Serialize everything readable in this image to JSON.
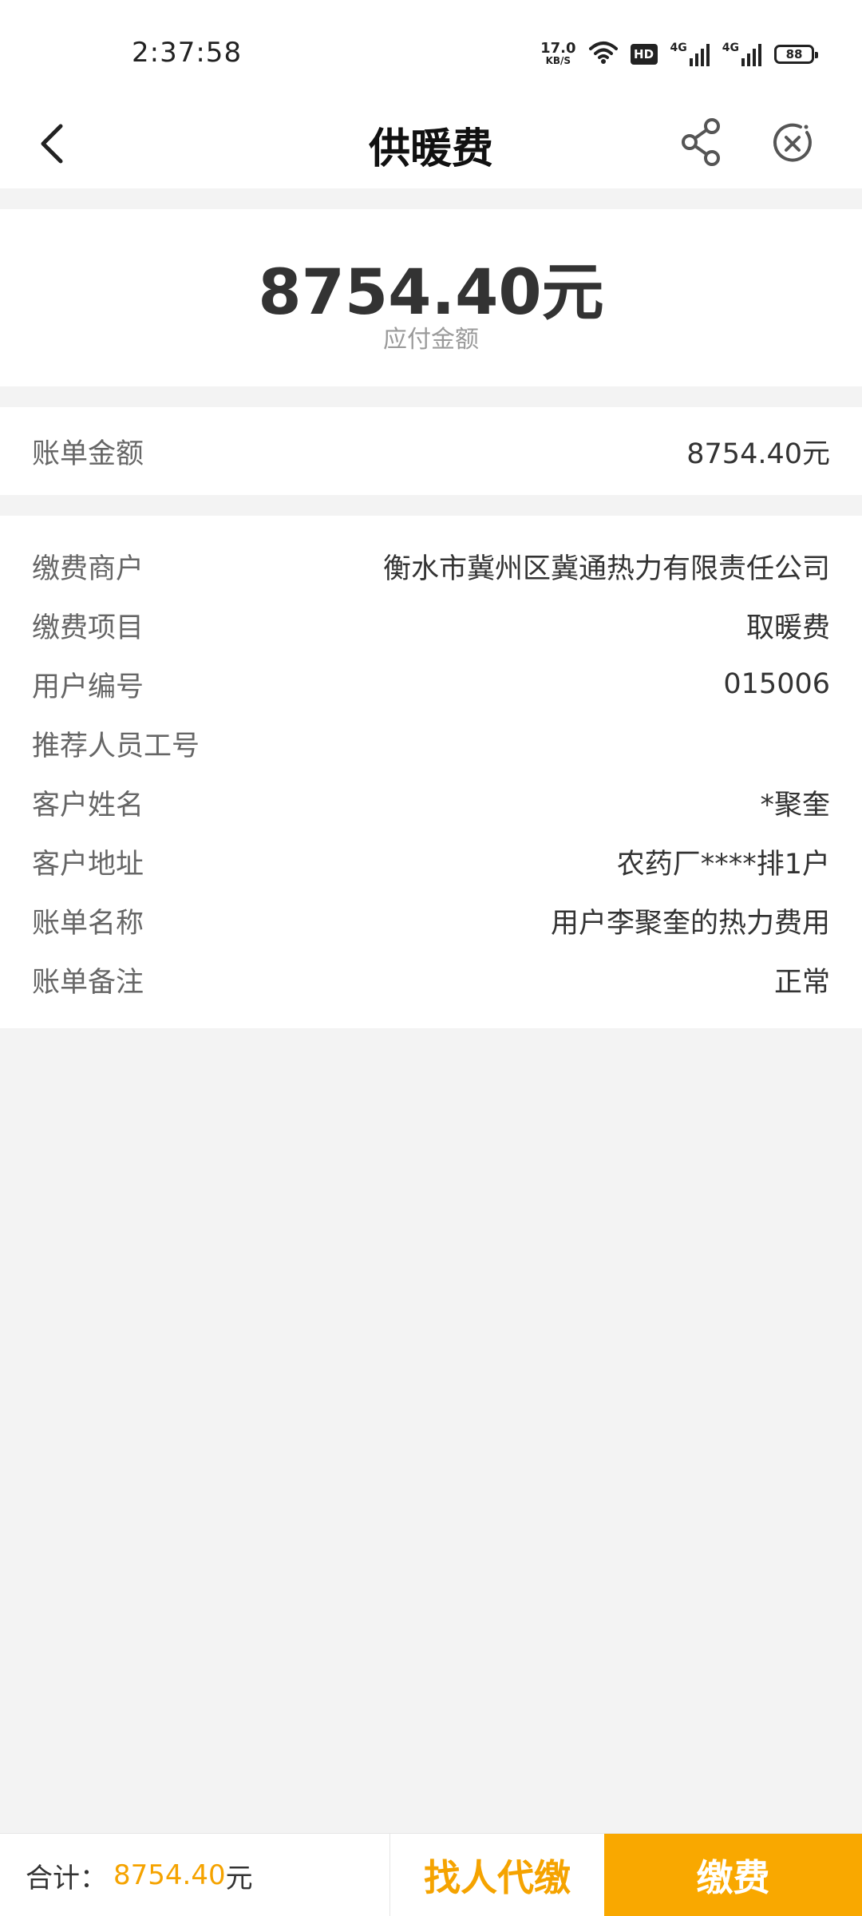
{
  "status_bar": {
    "time": "2:37:58",
    "net_speed": "17.0",
    "net_unit": "KB/S",
    "hd_badge": "HD",
    "signal1_label": "4G",
    "signal2_label": "4G",
    "battery": "88"
  },
  "nav": {
    "title": "供暖费",
    "back_icon": "chevron-left-icon",
    "share_icon": "share-icon",
    "close_icon": "close-circle-icon"
  },
  "amount": {
    "value": "8754.40元",
    "label": "应付金额"
  },
  "bill": {
    "label": "账单金额",
    "value": "8754.40元"
  },
  "details": [
    {
      "label": "缴费商户",
      "value": "衡水市冀州区冀通热力有限责任公司"
    },
    {
      "label": "缴费项目",
      "value": "取暖费"
    },
    {
      "label": "用户编号",
      "value": "015006"
    },
    {
      "label": "推荐人员工号",
      "value": ""
    },
    {
      "label": "客户姓名",
      "value": "*聚奎"
    },
    {
      "label": "客户地址",
      "value": "农药厂****排1户"
    },
    {
      "label": "账单名称",
      "value": "用户李聚奎的热力费用"
    },
    {
      "label": "账单备注",
      "value": "正常"
    }
  ],
  "bottom": {
    "total_label": "合计：",
    "total_value": "8754.40",
    "total_unit": "元",
    "proxy_label": "找人代缴",
    "pay_label": "缴费"
  },
  "colors": {
    "accent": "#f9a800",
    "accent_text": "#f5a300",
    "background": "#f3f3f3"
  }
}
